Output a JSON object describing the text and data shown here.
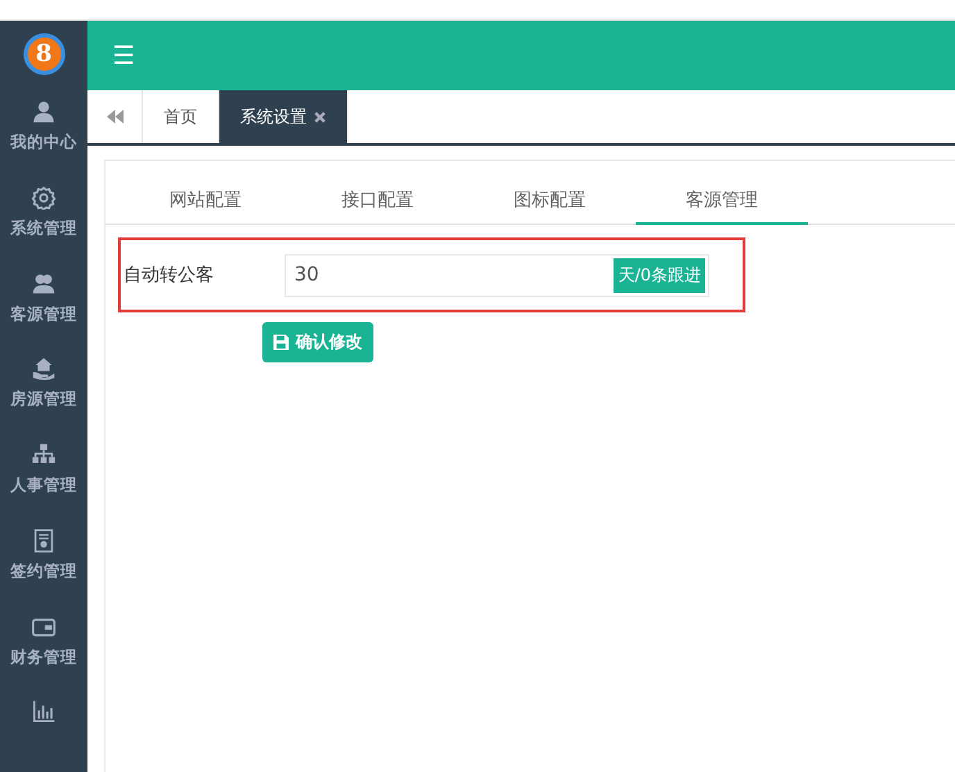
{
  "logo": {
    "text": "8"
  },
  "sidebar": {
    "items": [
      {
        "label": "我的中心",
        "kind": "user"
      },
      {
        "label": "系统管理",
        "kind": "gear"
      },
      {
        "label": "客源管理",
        "kind": "users"
      },
      {
        "label": "房源管理",
        "kind": "house"
      },
      {
        "label": "人事管理",
        "kind": "org"
      },
      {
        "label": "签约管理",
        "kind": "contract"
      },
      {
        "label": "财务管理",
        "kind": "wallet"
      },
      {
        "kind": "chart"
      }
    ]
  },
  "header": {
    "menu_icon": "☰"
  },
  "page_tabs": [
    {
      "label": "首页",
      "selected": false,
      "closable": false
    },
    {
      "label": "系统设置",
      "selected": true,
      "closable": true
    }
  ],
  "settings_tabs": [
    {
      "label": "网站配置",
      "selected": false
    },
    {
      "label": "接口配置",
      "selected": false
    },
    {
      "label": "图标配置",
      "selected": false
    },
    {
      "label": "客源管理",
      "selected": true
    }
  ],
  "form": {
    "label": "自动转公客",
    "value": "30",
    "addon": "天/0条跟进",
    "highlighted": true
  },
  "submit_button": "确认修改"
}
